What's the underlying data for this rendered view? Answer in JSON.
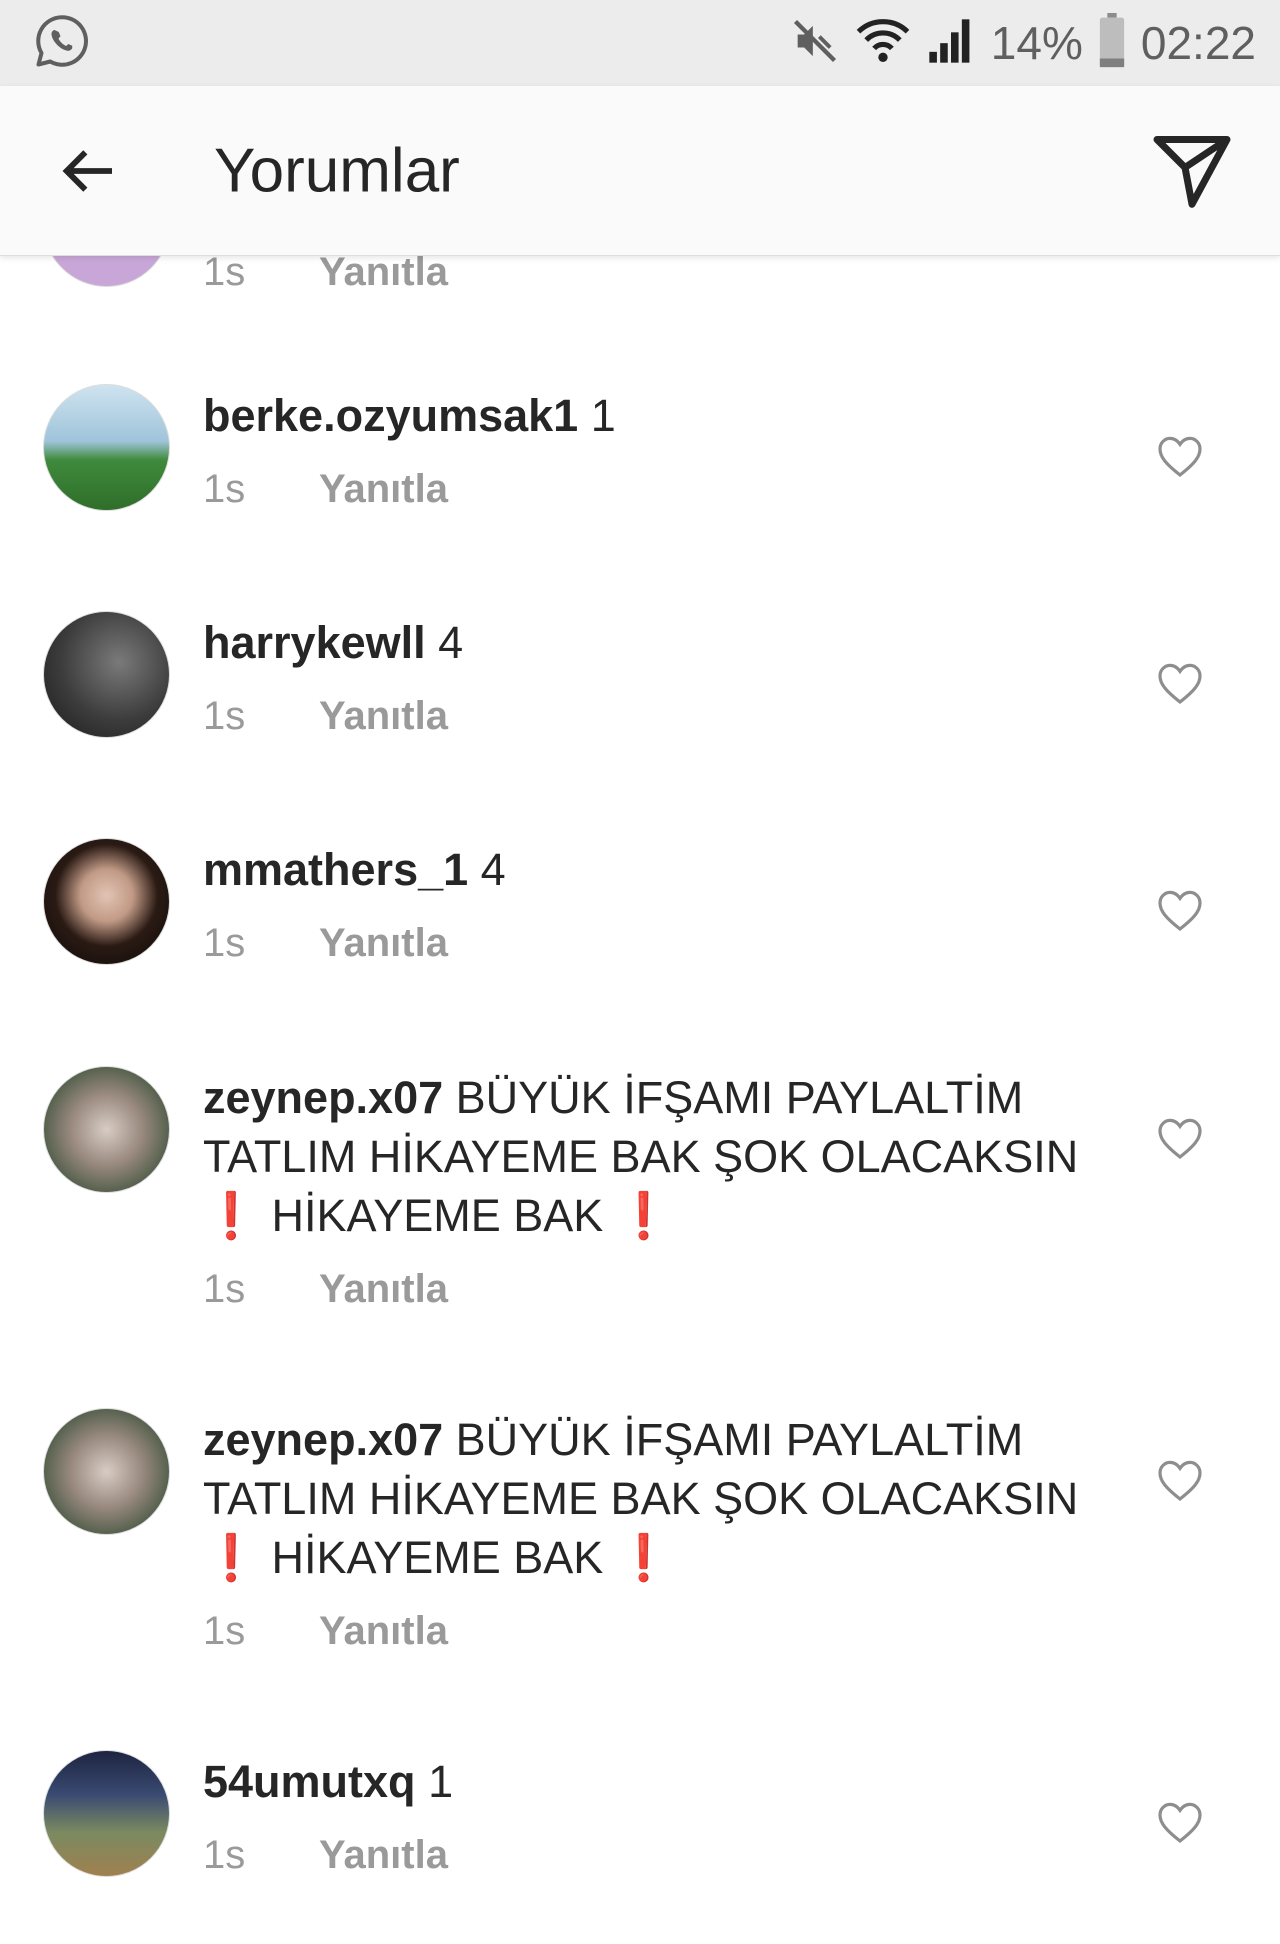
{
  "status_bar": {
    "battery": "14%",
    "time": "02:22",
    "icons": [
      "whatsapp-icon",
      "mute-icon",
      "wifi-icon",
      "signal-icon",
      "battery-icon"
    ]
  },
  "header": {
    "title": "Yorumlar",
    "icons": [
      "back-arrow-icon",
      "send-icon"
    ]
  },
  "partial_comment": {
    "time": "1s",
    "reply_label": "Yanıtla"
  },
  "comments": [
    {
      "username": "berke.ozyumsak1",
      "text": "1",
      "time": "1s",
      "reply_label": "Yanıtla"
    },
    {
      "username": "harrykewll",
      "text": "4",
      "time": "1s",
      "reply_label": "Yanıtla"
    },
    {
      "username": "mmathers_1",
      "text": "4",
      "time": "1s",
      "reply_label": "Yanıtla"
    },
    {
      "username": "zeynep.x07",
      "text": "BÜYÜK İFŞAMI PAYLALTİM TATLIM HİKAYEME BAK ŞOK OLACAKSIN",
      "text2": "HİKAYEME BAK",
      "time": "1s",
      "reply_label": "Yanıtla"
    },
    {
      "username": "zeynep.x07",
      "text": "BÜYÜK İFŞAMI PAYLALTİM TATLIM HİKAYEME BAK ŞOK OLACAKSIN",
      "text2": "HİKAYEME BAK",
      "time": "1s",
      "reply_label": "Yanıtla"
    },
    {
      "username": "54umutxq",
      "text": "1",
      "time": "1s",
      "reply_label": "Yanıtla"
    }
  ]
}
